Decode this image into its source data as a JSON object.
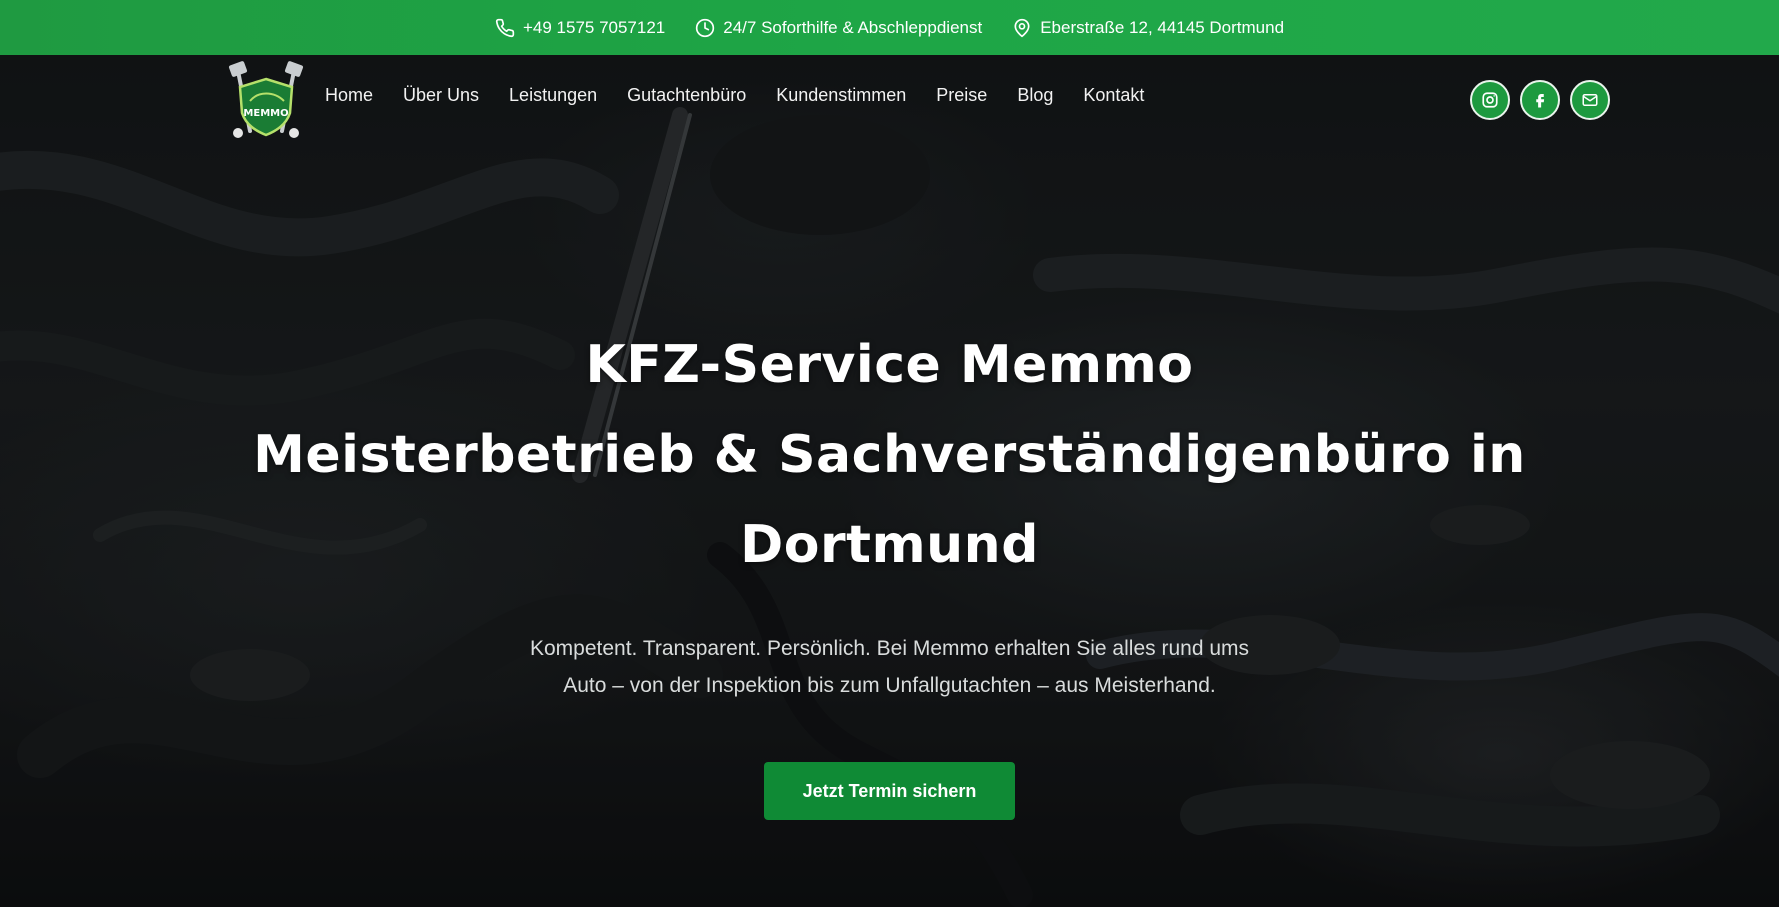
{
  "topbar": {
    "phone": "+49 1575 7057121",
    "service": "24/7 Soforthilfe & Abschleppdienst",
    "address": "Eberstraße 12, 44145 Dortmund",
    "icons": [
      "phone-icon",
      "clock-icon",
      "location-pin-icon"
    ]
  },
  "brand": {
    "logo_text": "MEMMO",
    "primary_color": "#1ea646",
    "button_color": "#0f8a35"
  },
  "nav": {
    "links": [
      {
        "label": "Home"
      },
      {
        "label": "Über Uns"
      },
      {
        "label": "Leistungen"
      },
      {
        "label": "Gutachtenbüro"
      },
      {
        "label": "Kundenstimmen"
      },
      {
        "label": "Preise"
      },
      {
        "label": "Blog"
      },
      {
        "label": "Kontakt"
      }
    ],
    "social": [
      "instagram-icon",
      "facebook-icon",
      "mail-icon"
    ]
  },
  "hero": {
    "title_line1": "KFZ-Service Memmo",
    "title_line2": "Meisterbetrieb & Sachverständigenbüro in",
    "title_line3": "Dortmund",
    "subtitle_line1": "Kompetent. Transparent. Persönlich. Bei Memmo erhalten Sie alles rund ums",
    "subtitle_line2": "Auto – von der Inspektion bis zum Unfallgutachten – aus Meisterhand.",
    "cta_label": "Jetzt Termin sichern"
  }
}
